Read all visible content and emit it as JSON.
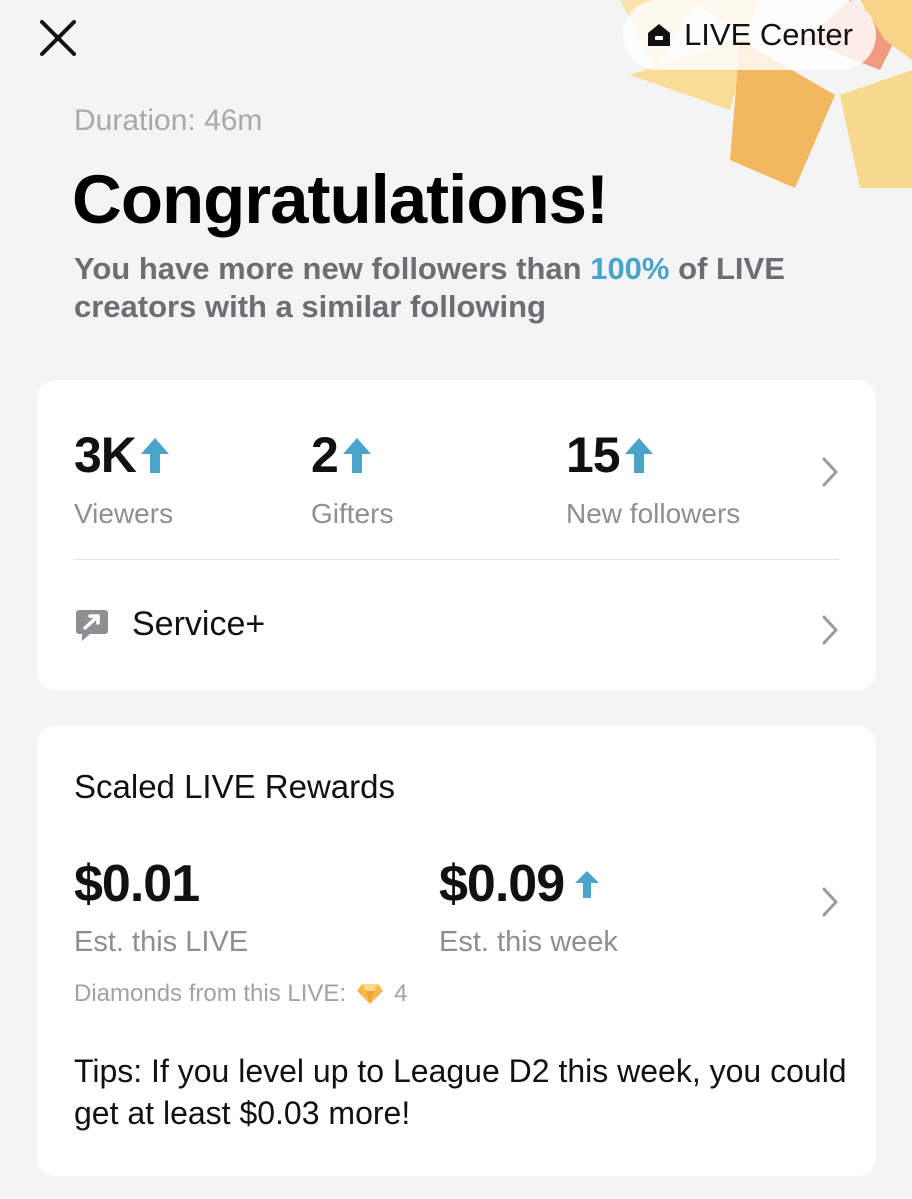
{
  "header": {
    "close_icon": "close-icon",
    "live_center_label": "LIVE Center",
    "live_center_icon": "home-icon"
  },
  "summary": {
    "duration": "Duration: 46m",
    "title": "Congratulations!",
    "subtitle_before": "You have more new followers than ",
    "subtitle_highlight": "100%",
    "subtitle_after": " of LIVE creators with a similar following",
    "highlight_color": "#4aa3c8"
  },
  "stats": [
    {
      "value": "3K",
      "label": "Viewers",
      "trend": "up"
    },
    {
      "value": "2",
      "label": "Gifters",
      "trend": "up"
    },
    {
      "value": "15",
      "label": "New followers",
      "trend": "up"
    }
  ],
  "service": {
    "label": "Service+",
    "icon": "service-chat-icon"
  },
  "rewards": {
    "title": "Scaled LIVE Rewards",
    "this_live_value": "$0.01",
    "this_live_label": "Est. this LIVE",
    "this_week_value": "$0.09",
    "this_week_label": "Est. this week",
    "this_week_trend": "up",
    "diamonds_label": "Diamonds from this LIVE:",
    "diamonds_count": "4",
    "diamond_icon": "diamond-icon",
    "tips": "Tips: If you level up to League D2 this week, you could get at least $0.03 more!"
  },
  "colors": {
    "accent_arrow": "#4aa3c8",
    "background": "#f4f4f5",
    "decor_yellow": "#f8d98a",
    "decor_orange": "#f2b65e",
    "decor_red": "#ef8a6b"
  }
}
